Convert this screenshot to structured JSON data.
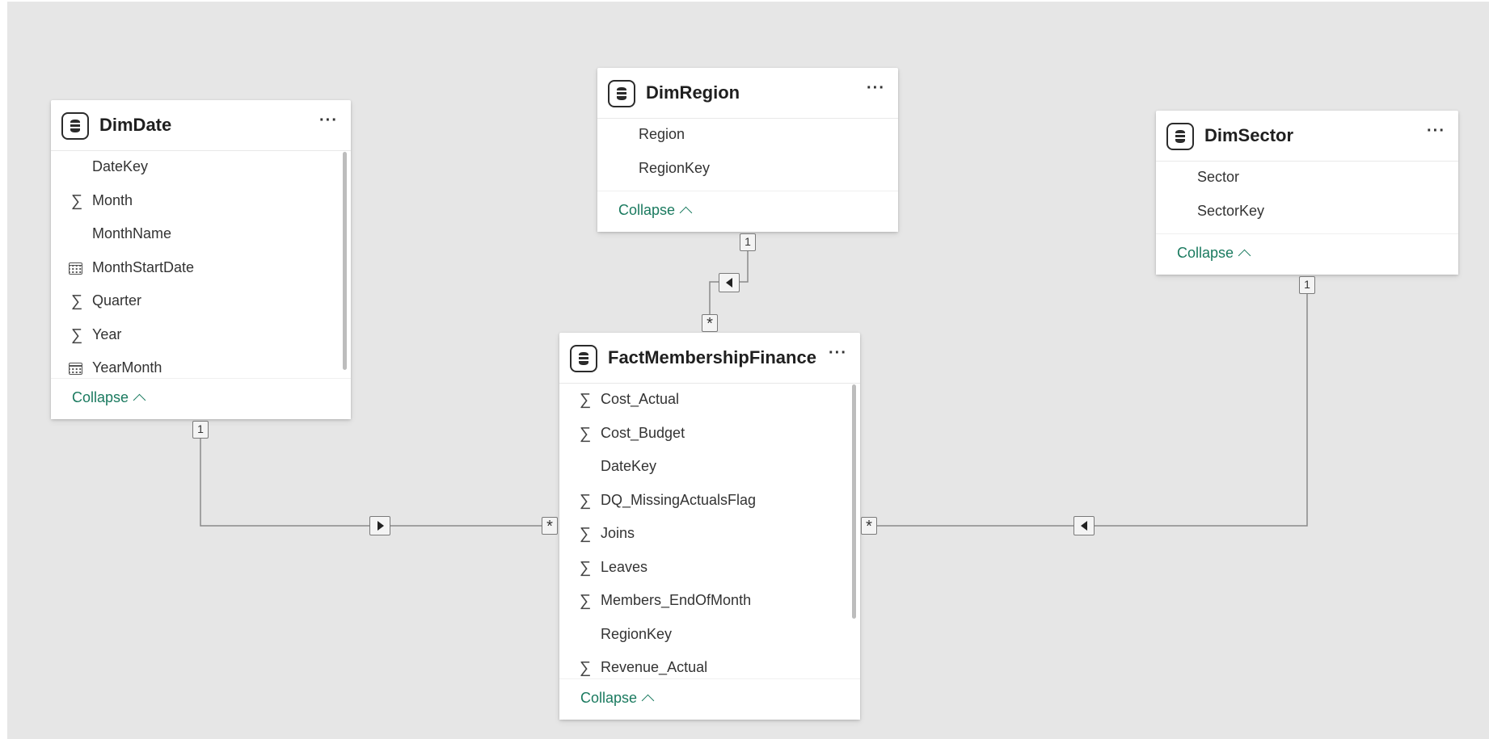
{
  "tables": {
    "dimdate": {
      "title": "DimDate",
      "more": "···",
      "collapse": "Collapse",
      "fields": [
        {
          "label": "DateKey",
          "icon": "none"
        },
        {
          "label": "Month",
          "icon": "sigma"
        },
        {
          "label": "MonthName",
          "icon": "none"
        },
        {
          "label": "MonthStartDate",
          "icon": "calendar"
        },
        {
          "label": "Quarter",
          "icon": "sigma"
        },
        {
          "label": "Year",
          "icon": "sigma"
        },
        {
          "label": "YearMonth",
          "icon": "calendar"
        }
      ]
    },
    "dimregion": {
      "title": "DimRegion",
      "more": "···",
      "collapse": "Collapse",
      "fields": [
        {
          "label": "Region",
          "icon": "none"
        },
        {
          "label": "RegionKey",
          "icon": "none"
        }
      ]
    },
    "dimsector": {
      "title": "DimSector",
      "more": "···",
      "collapse": "Collapse",
      "fields": [
        {
          "label": "Sector",
          "icon": "none"
        },
        {
          "label": "SectorKey",
          "icon": "none"
        }
      ]
    },
    "fact": {
      "title": "FactMembershipFinance",
      "more": "···",
      "collapse": "Collapse",
      "fields": [
        {
          "label": "Cost_Actual",
          "icon": "sigma"
        },
        {
          "label": "Cost_Budget",
          "icon": "sigma"
        },
        {
          "label": "DateKey",
          "icon": "none"
        },
        {
          "label": "DQ_MissingActualsFlag",
          "icon": "sigma"
        },
        {
          "label": "Joins",
          "icon": "sigma"
        },
        {
          "label": "Leaves",
          "icon": "sigma"
        },
        {
          "label": "Members_EndOfMonth",
          "icon": "sigma"
        },
        {
          "label": "RegionKey",
          "icon": "none"
        },
        {
          "label": "Revenue_Actual",
          "icon": "sigma"
        }
      ]
    }
  },
  "relationships": {
    "date_fact": {
      "one": "1",
      "many": "*",
      "direction": "right"
    },
    "region_fact": {
      "one": "1",
      "many": "*",
      "direction": "left"
    },
    "sector_fact": {
      "one": "1",
      "many": "*",
      "direction": "left"
    }
  },
  "colors": {
    "canvas": "#e6e6e6",
    "line": "#8a8a8a",
    "collapse_link": "#1a7a5f"
  }
}
